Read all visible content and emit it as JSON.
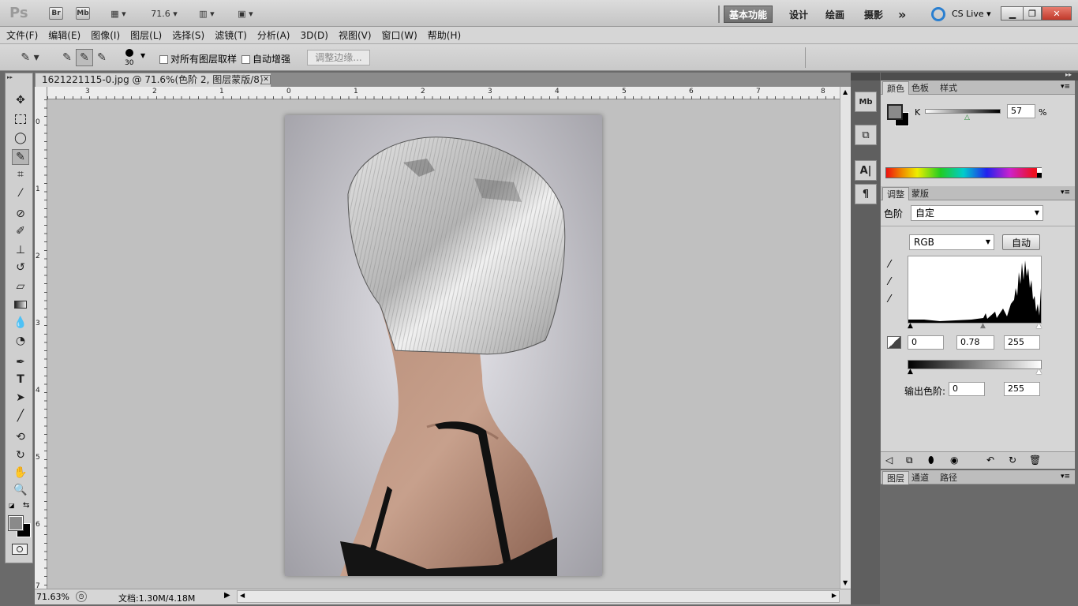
{
  "app": {
    "logo": "Ps",
    "zoom_value": "71.6",
    "cs_live": "CS Live"
  },
  "titlebar": {
    "br": "Br",
    "mb": "Mb",
    "workspaces": [
      "基本功能",
      "设计",
      "绘画",
      "摄影"
    ],
    "more": "»"
  },
  "menu": [
    "文件(F)",
    "编辑(E)",
    "图像(I)",
    "图层(L)",
    "选择(S)",
    "滤镜(T)",
    "分析(A)",
    "3D(D)",
    "视图(V)",
    "窗口(W)",
    "帮助(H)"
  ],
  "options": {
    "brush_size": "30",
    "sample_all_layers": "对所有图层取样",
    "auto_enhance": "自动增强",
    "refine_edge": "调整边缘..."
  },
  "document": {
    "tab_title": "1621221115-0.jpg @ 71.6%(色阶 2, 图层蒙版/8) *",
    "zoom_status": "71.63%",
    "doc_info": "文档:1.30M/4.18M",
    "ruler_top": [
      "3",
      "2",
      "1",
      "0",
      "1",
      "2",
      "3",
      "4",
      "5",
      "6",
      "7",
      "8"
    ],
    "ruler_left": [
      "0",
      "1",
      "2",
      "3",
      "4",
      "5",
      "6",
      "7"
    ]
  },
  "color_panel": {
    "tabs": [
      "颜色",
      "色板",
      "样式"
    ],
    "channel": "K",
    "value": "57",
    "unit": "%"
  },
  "adjust_panel": {
    "tabs": [
      "调整",
      "蒙版"
    ],
    "title": "色阶",
    "preset": "自定",
    "channel": "RGB",
    "auto_label": "自动",
    "input_black": "0",
    "input_gamma": "0.78",
    "input_white": "255",
    "output_label": "输出色阶:",
    "output_black": "0",
    "output_white": "255"
  },
  "layers_panel": {
    "tabs": [
      "图层",
      "通道",
      "路径"
    ]
  },
  "dock_icons": [
    "mini-bridge-icon",
    "history-icon",
    "character-icon",
    "paragraph-icon"
  ],
  "colors": {
    "foreground": "#8a8a8a",
    "background": "#000000",
    "active_workspace": "#7a7a7a"
  }
}
